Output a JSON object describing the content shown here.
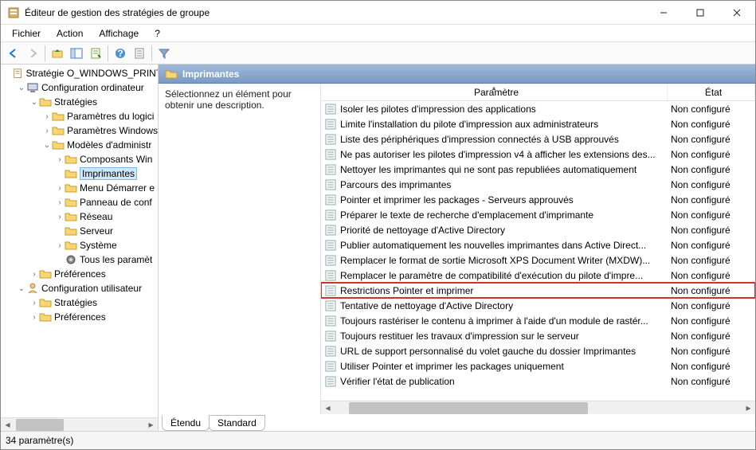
{
  "window": {
    "title": "Éditeur de gestion des stratégies de groupe"
  },
  "menu": {
    "file": "Fichier",
    "action": "Action",
    "view": "Affichage",
    "help": "?"
  },
  "header": {
    "title": "Imprimantes"
  },
  "desc": {
    "text": "Sélectionnez un élément pour obtenir une description."
  },
  "columns": {
    "param": "Paramètre",
    "etat": "État"
  },
  "tabs": {
    "extended": "Étendu",
    "standard": "Standard"
  },
  "status": {
    "text": "34 paramètre(s)"
  },
  "tree": [
    {
      "depth": 0,
      "toggle": "",
      "icon": "policy",
      "label": "Stratégie O_WINDOWS_PRINT_D",
      "selected": false
    },
    {
      "depth": 1,
      "toggle": "open",
      "icon": "computer",
      "label": "Configuration ordinateur"
    },
    {
      "depth": 2,
      "toggle": "open",
      "icon": "folder",
      "label": "Stratégies"
    },
    {
      "depth": 3,
      "toggle": "closed",
      "icon": "folder",
      "label": "Paramètres du logici"
    },
    {
      "depth": 3,
      "toggle": "closed",
      "icon": "folder",
      "label": "Paramètres Windows"
    },
    {
      "depth": 3,
      "toggle": "open",
      "icon": "folder",
      "label": "Modèles d'administr"
    },
    {
      "depth": 4,
      "toggle": "closed",
      "icon": "folder",
      "label": "Composants Win"
    },
    {
      "depth": 4,
      "toggle": "",
      "icon": "folder",
      "label": "Imprimantes",
      "selected": true
    },
    {
      "depth": 4,
      "toggle": "closed",
      "icon": "folder",
      "label": "Menu Démarrer e"
    },
    {
      "depth": 4,
      "toggle": "closed",
      "icon": "folder",
      "label": "Panneau de conf"
    },
    {
      "depth": 4,
      "toggle": "closed",
      "icon": "folder",
      "label": "Réseau"
    },
    {
      "depth": 4,
      "toggle": "",
      "icon": "folder",
      "label": "Serveur"
    },
    {
      "depth": 4,
      "toggle": "closed",
      "icon": "folder",
      "label": "Système"
    },
    {
      "depth": 4,
      "toggle": "",
      "icon": "settings",
      "label": "Tous les paramèt"
    },
    {
      "depth": 2,
      "toggle": "closed",
      "icon": "folder",
      "label": "Préférences"
    },
    {
      "depth": 1,
      "toggle": "open",
      "icon": "user",
      "label": "Configuration utilisateur"
    },
    {
      "depth": 2,
      "toggle": "closed",
      "icon": "folder",
      "label": "Stratégies"
    },
    {
      "depth": 2,
      "toggle": "closed",
      "icon": "folder",
      "label": "Préférences"
    }
  ],
  "items": [
    {
      "label": "Isoler les pilotes d'impression des applications",
      "state": "Non configuré"
    },
    {
      "label": "Limite l'installation du pilote d'impression aux administrateurs",
      "state": "Non configuré"
    },
    {
      "label": "Liste des périphériques d'impression connectés à USB approuvés",
      "state": "Non configuré"
    },
    {
      "label": "Ne pas autoriser les pilotes d'impression v4 à afficher les extensions des...",
      "state": "Non configuré"
    },
    {
      "label": "Nettoyer les imprimantes qui ne sont pas republiées automatiquement",
      "state": "Non configuré"
    },
    {
      "label": "Parcours des imprimantes",
      "state": "Non configuré"
    },
    {
      "label": "Pointer et imprimer les packages - Serveurs approuvés",
      "state": "Non configuré"
    },
    {
      "label": "Préparer le texte de recherche d'emplacement d'imprimante",
      "state": "Non configuré"
    },
    {
      "label": "Priorité de nettoyage d'Active Directory",
      "state": "Non configuré"
    },
    {
      "label": "Publier automatiquement les nouvelles imprimantes dans Active Direct...",
      "state": "Non configuré"
    },
    {
      "label": "Remplacer le format de sortie Microsoft XPS Document Writer (MXDW)...",
      "state": "Non configuré"
    },
    {
      "label": "Remplacer le paramètre de compatibilité d'exécution du pilote d'impre...",
      "state": "Non configuré"
    },
    {
      "label": "Restrictions Pointer et imprimer",
      "state": "Non configuré",
      "highlight": true
    },
    {
      "label": "Tentative de nettoyage d'Active Directory",
      "state": "Non configuré"
    },
    {
      "label": "Toujours rastériser le contenu à imprimer à l'aide d'un module de rastér...",
      "state": "Non configuré"
    },
    {
      "label": "Toujours restituer les travaux d'impression sur le serveur",
      "state": "Non configuré"
    },
    {
      "label": "URL de support personnalisé du volet gauche du dossier Imprimantes",
      "state": "Non configuré"
    },
    {
      "label": "Utiliser Pointer et imprimer les packages uniquement",
      "state": "Non configuré"
    },
    {
      "label": "Vérifier l'état de publication",
      "state": "Non configuré"
    }
  ]
}
